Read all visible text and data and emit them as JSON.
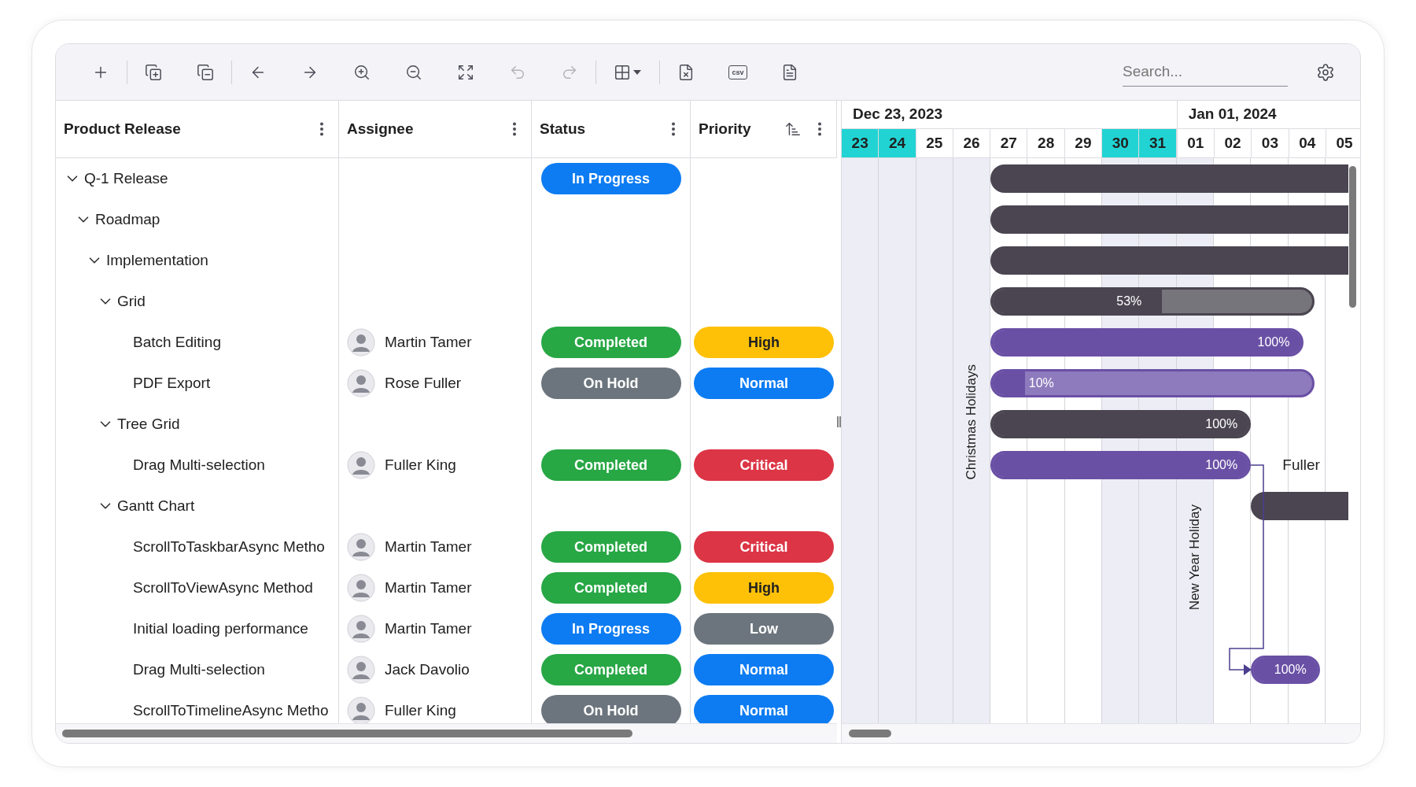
{
  "toolbar": {
    "buttons": [
      {
        "disabled": false
      },
      {
        "disabled": false
      },
      {
        "disabled": false
      },
      {
        "disabled": false
      },
      {
        "disabled": false
      },
      {
        "disabled": false
      },
      {
        "disabled": false
      },
      {
        "disabled": false
      },
      {
        "disabled": true
      },
      {
        "disabled": true
      },
      {
        "disabled": false
      },
      {
        "disabled": false
      },
      {
        "disabled": false,
        "label": "csv"
      },
      {
        "disabled": false
      }
    ],
    "search": {
      "placeholder": "Search..."
    }
  },
  "columns": [
    {
      "label": "Product Release",
      "sorted": false
    },
    {
      "label": "Assignee",
      "sorted": false
    },
    {
      "label": "Status",
      "sorted": false
    },
    {
      "label": "Priority",
      "sorted": true
    }
  ],
  "timeline": {
    "months": [
      {
        "label": "Dec 23, 2023",
        "days": [
          {
            "label": "23",
            "weekend": true,
            "non_working": true
          },
          {
            "label": "24",
            "weekend": true,
            "non_working": true
          },
          {
            "label": "25",
            "weekend": false,
            "non_working": true
          },
          {
            "label": "26",
            "weekend": false,
            "non_working": true,
            "holiday": "Christmas Holidays"
          },
          {
            "label": "27",
            "weekend": false,
            "non_working": false
          },
          {
            "label": "28",
            "weekend": false,
            "non_working": false
          },
          {
            "label": "29",
            "weekend": false,
            "non_working": false
          },
          {
            "label": "30",
            "weekend": true,
            "non_working": true
          },
          {
            "label": "31",
            "weekend": true,
            "non_working": true
          }
        ]
      },
      {
        "label": "Jan 01, 2024",
        "days": [
          {
            "label": "01",
            "weekend": false,
            "non_working": true,
            "holiday": "New Year Holiday"
          },
          {
            "label": "02",
            "weekend": false,
            "non_working": false
          },
          {
            "label": "03",
            "weekend": false,
            "non_working": false
          },
          {
            "label": "04",
            "weekend": false,
            "non_working": false
          },
          {
            "label": "05",
            "weekend": false,
            "non_working": false
          }
        ]
      }
    ]
  },
  "rows": [
    {
      "name": "Q-1 Release",
      "expanded": true,
      "status": {
        "label": "In Progress",
        "color": "#0d7cf2"
      },
      "bar": {
        "kind": "parent"
      },
      "children": [
        {
          "name": "Roadmap",
          "expanded": true,
          "bar": {
            "kind": "parent"
          },
          "children": [
            {
              "name": "Implementation",
              "expanded": true,
              "bar": {
                "kind": "parent"
              },
              "children": [
                {
                  "name": "Grid",
                  "expanded": true,
                  "bar": {
                    "kind": "parent",
                    "level": 0.53,
                    "label": "53%"
                  },
                  "children": [
                    {
                      "name": "Batch Editing",
                      "assignee": "Martin Tamer",
                      "status": {
                        "label": "Completed",
                        "color": "#28a745"
                      },
                      "priority": {
                        "label": "High",
                        "color": "#ffc107"
                      },
                      "bar": {
                        "kind": "child",
                        "level": 1,
                        "label": "100%"
                      }
                    },
                    {
                      "name": "PDF Export",
                      "assignee": "Rose Fuller",
                      "status": {
                        "label": "On Hold",
                        "color": "#6c757d"
                      },
                      "priority": {
                        "label": "Normal",
                        "color": "#0d7cf2"
                      },
                      "bar": {
                        "kind": "child",
                        "level": 0.1,
                        "label": "10%"
                      }
                    }
                  ]
                },
                {
                  "name": "Tree Grid",
                  "expanded": true,
                  "bar": {
                    "kind": "parent",
                    "level": 1,
                    "label": "100%"
                  },
                  "children": [
                    {
                      "name": "Drag Multi-selection",
                      "assignee": "Fuller King",
                      "status": {
                        "label": "Completed",
                        "color": "#28a745"
                      },
                      "priority": {
                        "label": "Critical",
                        "color": "#dc3545"
                      },
                      "bar": {
                        "kind": "child",
                        "level": 1,
                        "label": "100%",
                        "resource": "Fuller"
                      }
                    }
                  ]
                },
                {
                  "name": "Gantt Chart",
                  "expanded": true,
                  "bar": {
                    "kind": "parent"
                  },
                  "children": [
                    {
                      "name": "ScrollToTaskbarAsync Metho",
                      "assignee": "Martin Tamer",
                      "status": {
                        "label": "Completed",
                        "color": "#28a745"
                      },
                      "priority": {
                        "label": "Critical",
                        "color": "#dc3545"
                      }
                    },
                    {
                      "name": "ScrollToViewAsync Method",
                      "assignee": "Martin Tamer",
                      "status": {
                        "label": "Completed",
                        "color": "#28a745"
                      },
                      "priority": {
                        "label": "High",
                        "color": "#ffc107"
                      }
                    },
                    {
                      "name": "Initial loading performance",
                      "assignee": "Martin Tamer",
                      "status": {
                        "label": "In Progress",
                        "color": "#0d7cf2"
                      },
                      "priority": {
                        "label": "Low",
                        "color": "#6c757d"
                      }
                    },
                    {
                      "name": "Drag Multi-selection",
                      "assignee": "Jack Davolio",
                      "status": {
                        "label": "Completed",
                        "color": "#28a745"
                      },
                      "priority": {
                        "label": "Normal",
                        "color": "#0d7cf2"
                      },
                      "bar": {
                        "kind": "child",
                        "level": 1,
                        "label": "100%"
                      }
                    },
                    {
                      "name": "ScrollToTimelineAsync Metho",
                      "assignee": "Fuller King",
                      "status": {
                        "label": "On Hold",
                        "color": "#6c757d"
                      },
                      "priority": {
                        "label": "Normal",
                        "color": "#0d7cf2"
                      }
                    }
                  ]
                }
              ]
            }
          ]
        }
      ]
    }
  ]
}
